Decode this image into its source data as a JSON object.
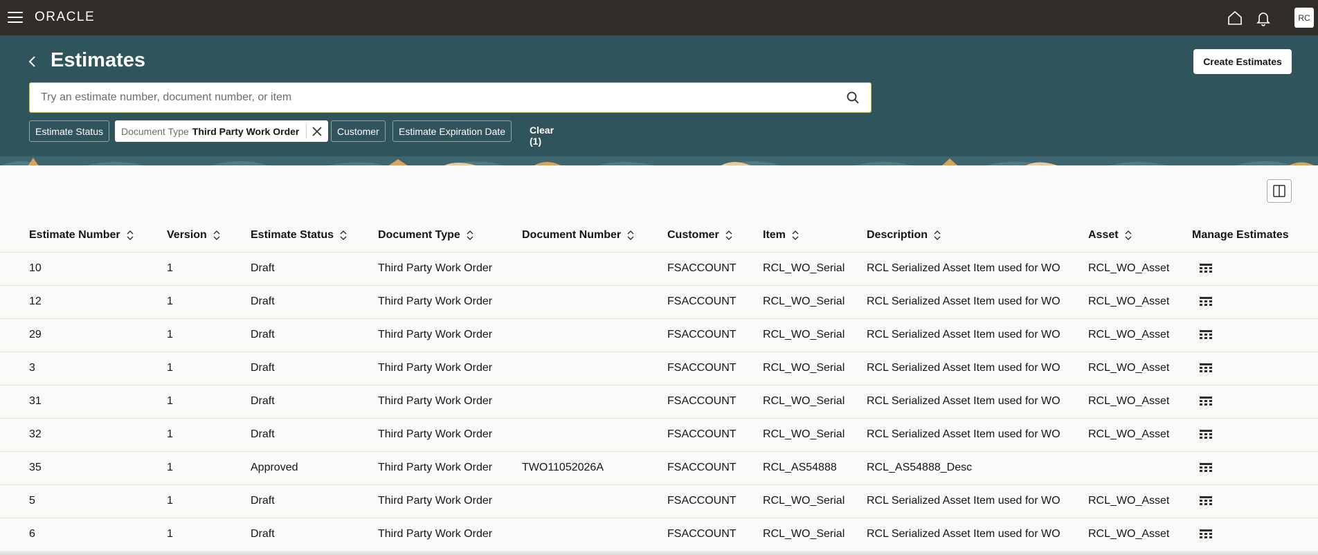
{
  "topbar": {
    "logo": "ORACLE",
    "avatar": "RC",
    "icons": [
      "menu-icon",
      "home-icon",
      "bell-icon"
    ]
  },
  "header": {
    "title": "Estimates",
    "create_label": "Create Estimates",
    "search_placeholder": "Try an estimate number, document number, or item",
    "chips": {
      "estimate_status": "Estimate Status",
      "document_type_key": "Document Type",
      "document_type_value": "Third Party Work Order",
      "customer": "Customer",
      "expiration": "Estimate Expiration Date",
      "clear": "Clear (1)"
    },
    "colors": {
      "band": "#30545b",
      "topbar": "#312d2a"
    }
  },
  "table": {
    "columns": [
      "Estimate Number",
      "Version",
      "Estimate Status",
      "Document Type",
      "Document Number",
      "Customer",
      "Item",
      "Description",
      "Asset",
      "Manage Estimates"
    ],
    "rows": [
      [
        "10",
        "1",
        "Draft",
        "Third Party Work Order",
        "",
        "FSACCOUNT",
        "RCL_WO_Serial",
        "RCL Serialized Asset Item used for WO",
        "RCL_WO_Asset"
      ],
      [
        "12",
        "1",
        "Draft",
        "Third Party Work Order",
        "",
        "FSACCOUNT",
        "RCL_WO_Serial",
        "RCL Serialized Asset Item used for WO",
        "RCL_WO_Asset"
      ],
      [
        "29",
        "1",
        "Draft",
        "Third Party Work Order",
        "",
        "FSACCOUNT",
        "RCL_WO_Serial",
        "RCL Serialized Asset Item used for WO",
        "RCL_WO_Asset"
      ],
      [
        "3",
        "1",
        "Draft",
        "Third Party Work Order",
        "",
        "FSACCOUNT",
        "RCL_WO_Serial",
        "RCL Serialized Asset Item used for WO",
        "RCL_WO_Asset"
      ],
      [
        "31",
        "1",
        "Draft",
        "Third Party Work Order",
        "",
        "FSACCOUNT",
        "RCL_WO_Serial",
        "RCL Serialized Asset Item used for WO",
        "RCL_WO_Asset"
      ],
      [
        "32",
        "1",
        "Draft",
        "Third Party Work Order",
        "",
        "FSACCOUNT",
        "RCL_WO_Serial",
        "RCL Serialized Asset Item used for WO",
        "RCL_WO_Asset"
      ],
      [
        "35",
        "1",
        "Approved",
        "Third Party Work Order",
        "TWO11052026A",
        "FSACCOUNT",
        "RCL_AS54888",
        "RCL_AS54888_Desc",
        ""
      ],
      [
        "5",
        "1",
        "Draft",
        "Third Party Work Order",
        "",
        "FSACCOUNT",
        "RCL_WO_Serial",
        "RCL Serialized Asset Item used for WO",
        "RCL_WO_Asset"
      ],
      [
        "6",
        "1",
        "Draft",
        "Third Party Work Order",
        "",
        "FSACCOUNT",
        "RCL_WO_Serial",
        "RCL Serialized Asset Item used for WO",
        "RCL_WO_Asset"
      ]
    ]
  }
}
